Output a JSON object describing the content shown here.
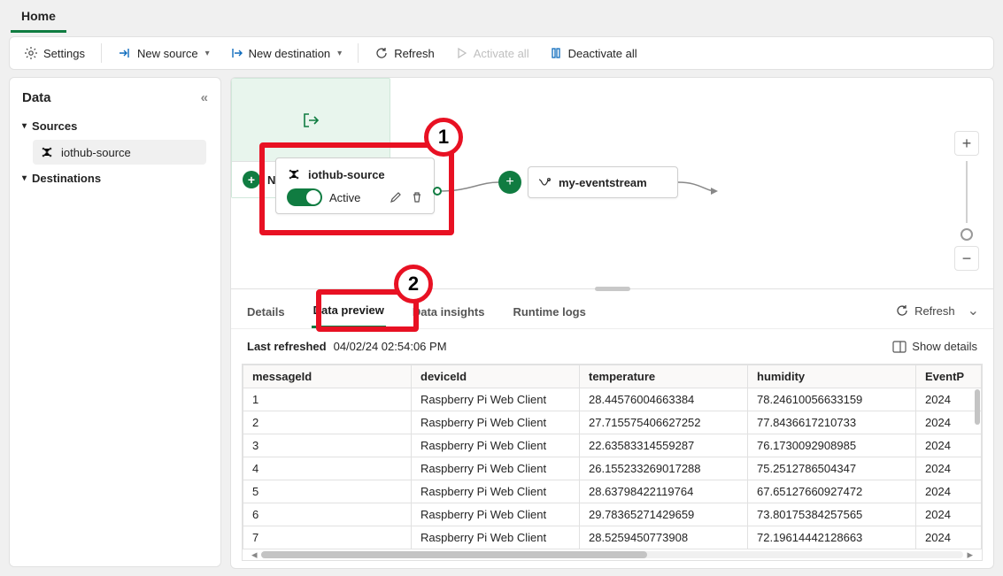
{
  "topTab": "Home",
  "toolbar": {
    "settings": "Settings",
    "newSource": "New source",
    "newDestination": "New destination",
    "refresh": "Refresh",
    "activateAll": "Activate all",
    "deactivateAll": "Deactivate all"
  },
  "sidebar": {
    "title": "Data",
    "sources": "Sources",
    "sourceItem": "iothub-source",
    "destinations": "Destinations"
  },
  "canvas": {
    "sourceNode": {
      "title": "iothub-source",
      "status": "Active"
    },
    "streamNode": "my-eventstream",
    "newDestination": "New destination",
    "callout1": "1",
    "callout2": "2"
  },
  "panel": {
    "tabs": {
      "details": "Details",
      "preview": "Data preview",
      "insights": "Data insights",
      "logs": "Runtime logs"
    },
    "refresh": "Refresh",
    "lastRefreshedLabel": "Last refreshed",
    "lastRefreshedValue": "04/02/24 02:54:06 PM",
    "showDetails": "Show details"
  },
  "table": {
    "headers": {
      "messageId": "messageId",
      "deviceId": "deviceId",
      "temperature": "temperature",
      "humidity": "humidity",
      "eventP": "EventP"
    },
    "rows": [
      {
        "messageId": "1",
        "deviceId": "Raspberry Pi Web Client",
        "temperature": "28.44576004663384",
        "humidity": "78.24610056633159",
        "event": "2024"
      },
      {
        "messageId": "2",
        "deviceId": "Raspberry Pi Web Client",
        "temperature": "27.715575406627252",
        "humidity": "77.8436617210733",
        "event": "2024"
      },
      {
        "messageId": "3",
        "deviceId": "Raspberry Pi Web Client",
        "temperature": "22.63583314559287",
        "humidity": "76.1730092908985",
        "event": "2024"
      },
      {
        "messageId": "4",
        "deviceId": "Raspberry Pi Web Client",
        "temperature": "26.155233269017288",
        "humidity": "75.2512786504347",
        "event": "2024"
      },
      {
        "messageId": "5",
        "deviceId": "Raspberry Pi Web Client",
        "temperature": "28.63798422119764",
        "humidity": "67.65127660927472",
        "event": "2024"
      },
      {
        "messageId": "6",
        "deviceId": "Raspberry Pi Web Client",
        "temperature": "29.78365271429659",
        "humidity": "73.80175384257565",
        "event": "2024"
      },
      {
        "messageId": "7",
        "deviceId": "Raspberry Pi Web Client",
        "temperature": "28.5259450773908",
        "humidity": "72.19614442128663",
        "event": "2024"
      }
    ]
  }
}
